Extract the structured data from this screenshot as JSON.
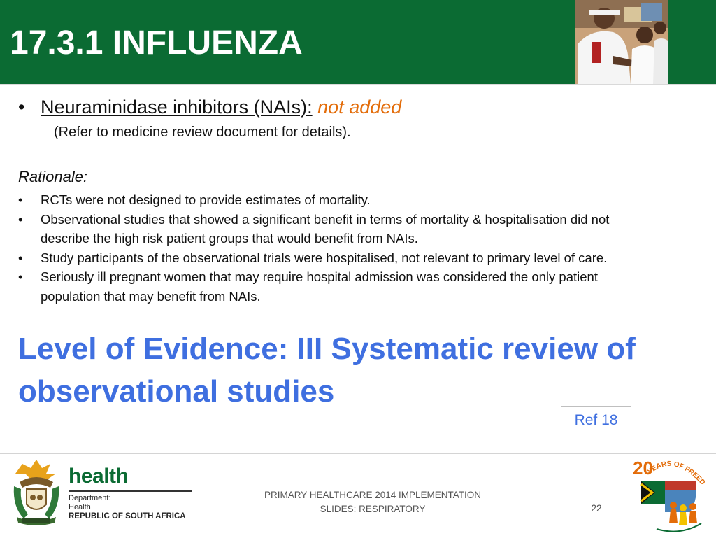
{
  "header": {
    "title": "17.3.1 INFLUENZA",
    "photo_icon": "nurse-child-photo-icon",
    "background_color": "#0b6b33"
  },
  "body": {
    "main_bullet": {
      "bullet": "•",
      "term": "Neuraminidase inhibitors (NAIs):",
      "status": "not added",
      "status_color": "#e36c09",
      "note": "(Refer to medicine review document for details)."
    },
    "rationale": {
      "heading": "Rationale:",
      "items": [
        {
          "bullet": "•",
          "lines": [
            "RCTs were not designed to provide estimates of mortality."
          ]
        },
        {
          "bullet": "•",
          "lines": [
            "Observational studies that showed a significant benefit in terms of mortality & hospitalisation did not",
            "describe the high risk patient groups that would benefit from NAIs."
          ]
        },
        {
          "bullet": "•",
          "lines": [
            "Study participants of the observational trials were hospitalised, not relevant to primary level of care."
          ]
        },
        {
          "bullet": "•",
          "lines": [
            "Seriously ill pregnant women that may require hospital admission was considered the only patient",
            "population that may benefit from NAIs."
          ]
        }
      ]
    },
    "evidence": {
      "line1": "Level of Evidence: III Systematic review of",
      "line2": "observational studies",
      "color": "#3f6fe0"
    },
    "reference": "Ref 18"
  },
  "footer": {
    "coat_of_arms_icon": "south-africa-coat-of-arms-icon",
    "health_logo": {
      "word": "health",
      "line1": "Department:",
      "line2": "Health",
      "line3": "REPUBLIC OF SOUTH AFRICA"
    },
    "caption_line1": "PRIMARY HEALTHCARE 2014 IMPLEMENTATION",
    "caption_line2": "SLIDES: RESPIRATORY",
    "page_number": "22",
    "freedom_logo": {
      "icon": "20-years-of-freedom-logo-icon",
      "number": "20",
      "text": "YEARS OF FREEDOM"
    }
  }
}
